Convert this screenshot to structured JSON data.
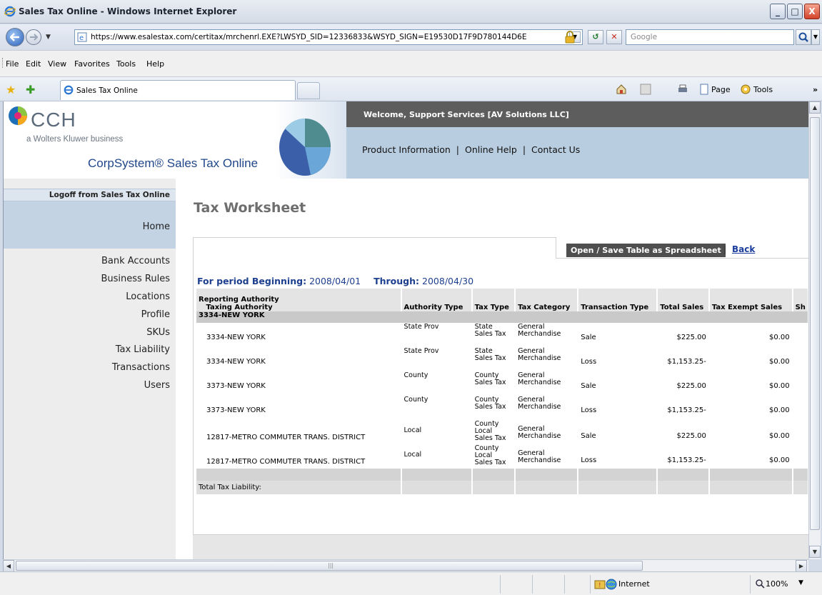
{
  "window": {
    "title": "Sales Tax Online - Windows Internet Explorer",
    "minimize": "_",
    "maximize": "□",
    "close": "X"
  },
  "address_bar": {
    "url": "https://www.esalestax.com/certitax/mrchenrl.EXE?LWSYD_SID=12336833&WSYD_SIGN=E19530D17F9D780144D6E",
    "search_placeholder": "Google"
  },
  "menu": [
    "File",
    "Edit",
    "View",
    "Favorites",
    "Tools",
    "Help"
  ],
  "tab": {
    "label": "Sales Tax Online"
  },
  "command_bar": {
    "page": "Page",
    "tools": "Tools"
  },
  "header": {
    "logo_name": "CCH",
    "logo_tagline": "a Wolters Kluwer business",
    "product": "CorpSystem® Sales Tax Online",
    "welcome": "Welcome, Support Services [AV Solutions LLC]",
    "links": [
      "Product Information",
      "Online Help",
      "Contact Us"
    ]
  },
  "sidebar": {
    "logoff": "Logoff from Sales Tax Online",
    "home": "Home",
    "items": [
      "Bank Accounts",
      "Business Rules",
      "Locations",
      "Profile",
      "SKUs",
      "Tax Liability",
      "Transactions",
      "Users"
    ]
  },
  "worksheet": {
    "title": "Tax Worksheet",
    "open_save": "Open / Save Table as Spreadsheet",
    "separator": "|",
    "back": "Back",
    "period_label": "For period Beginning:",
    "period_begin": "2008/04/01",
    "through_label": "Through:",
    "period_end": "2008/04/30"
  },
  "table": {
    "header_line1": "Reporting Authority",
    "header_line2": "Taxing Authority",
    "columns": [
      "Authority Type",
      "Tax Type",
      "Tax Category",
      "Transaction Type",
      "Total Sales",
      "Tax Exempt Sales",
      "Sh"
    ],
    "group": "3334-NEW YORK",
    "rows": [
      {
        "authority": "3334-NEW YORK",
        "auth_type": "State Prov",
        "tax_type": [
          "State",
          "Sales Tax"
        ],
        "category": [
          "General",
          "Merchandise"
        ],
        "trans": "Sale",
        "total": "$225.00",
        "exempt": "$0.00"
      },
      {
        "authority": "3334-NEW YORK",
        "auth_type": "State Prov",
        "tax_type": [
          "State",
          "Sales Tax"
        ],
        "category": [
          "General",
          "Merchandise"
        ],
        "trans": "Loss",
        "total": "$1,153.25-",
        "exempt": "$0.00"
      },
      {
        "authority": "3373-NEW YORK",
        "auth_type": "County",
        "tax_type": [
          "County",
          "Sales Tax"
        ],
        "category": [
          "General",
          "Merchandise"
        ],
        "trans": "Sale",
        "total": "$225.00",
        "exempt": "$0.00"
      },
      {
        "authority": "3373-NEW YORK",
        "auth_type": "County",
        "tax_type": [
          "County",
          "Sales Tax"
        ],
        "category": [
          "General",
          "Merchandise"
        ],
        "trans": "Loss",
        "total": "$1,153.25-",
        "exempt": "$0.00"
      },
      {
        "authority": "12817-METRO COMMUTER TRANS. DISTRICT",
        "auth_type": "Local",
        "tax_type": [
          "County",
          "Local",
          "Sales Tax"
        ],
        "category": [
          "General",
          "Merchandise"
        ],
        "trans": "Sale",
        "total": "$225.00",
        "exempt": "$0.00"
      },
      {
        "authority": "12817-METRO COMMUTER TRANS. DISTRICT",
        "auth_type": "Local",
        "tax_type": [
          "County",
          "Local",
          "Sales Tax"
        ],
        "category": [
          "General",
          "Merchandise"
        ],
        "trans": "Loss",
        "total": "$1,153.25-",
        "exempt": "$0.00"
      }
    ],
    "total_label": "Total Tax Liability:"
  },
  "status": {
    "zone": "Internet",
    "zoom": "100%"
  }
}
